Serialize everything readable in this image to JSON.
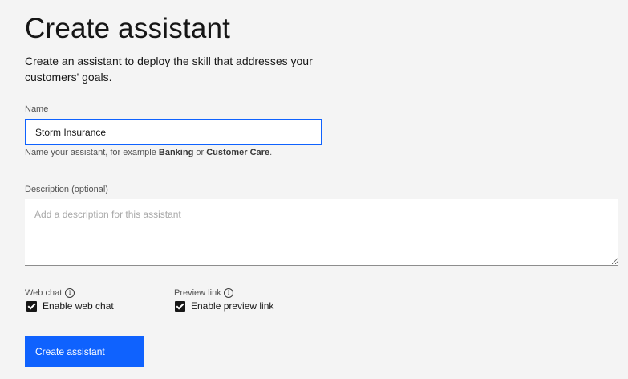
{
  "page": {
    "title": "Create assistant",
    "subtitle": "Create an assistant to deploy the skill that addresses your customers' goals."
  },
  "name_field": {
    "label": "Name",
    "value": "Storm Insurance",
    "helper_prefix": "Name your assistant, for example ",
    "helper_example1": "Banking",
    "helper_middle": " or ",
    "helper_example2": "Customer Care",
    "helper_suffix": "."
  },
  "description_field": {
    "label": "Description (optional)",
    "value": "",
    "placeholder": "Add a description for this assistant"
  },
  "web_chat": {
    "label": "Web chat",
    "checkbox_label": "Enable web chat",
    "checked": true
  },
  "preview_link": {
    "label": "Preview link",
    "checkbox_label": "Enable preview link",
    "checked": true
  },
  "actions": {
    "create_label": "Create assistant"
  },
  "colors": {
    "background": "#f4f4f4",
    "accent": "#0f62fe",
    "text": "#161616"
  }
}
